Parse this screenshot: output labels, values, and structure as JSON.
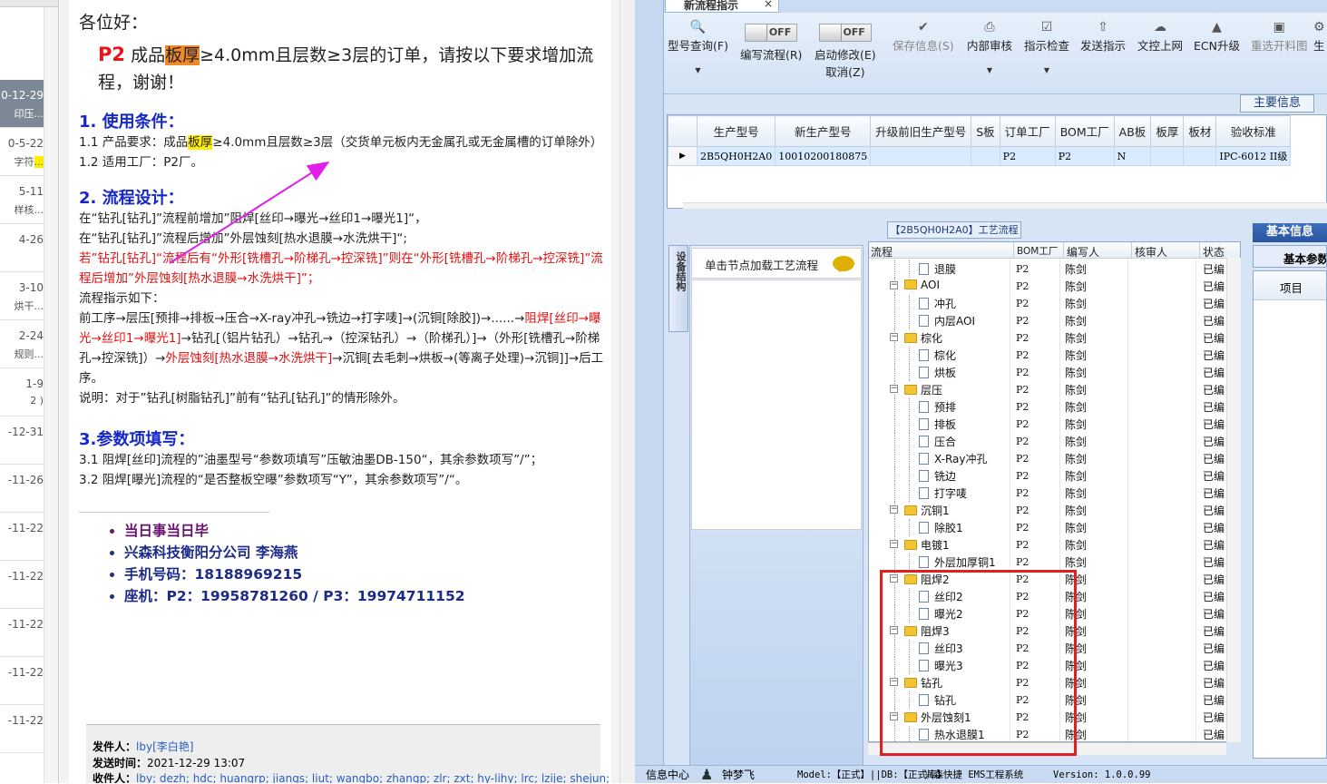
{
  "datelist": {
    "items": [
      {
        "date": "0-12-29",
        "sub": "印压...",
        "selected": true
      },
      {
        "date": "0-5-22",
        "sub": "字符",
        "highlight": "..."
      },
      {
        "date": "5-11",
        "sub": "样核..."
      },
      {
        "date": "4-26",
        "sub": ""
      },
      {
        "date": "3-10",
        "sub": "烘干..."
      },
      {
        "date": "2-24",
        "sub": "规则..."
      },
      {
        "date": "1-9",
        "sub": "2 )"
      },
      {
        "date": "-12-31",
        "sub": ""
      },
      {
        "date": "-11-26",
        "sub": ""
      },
      {
        "date": "-11-22",
        "sub": ""
      },
      {
        "date": "-11-22",
        "sub": ""
      },
      {
        "date": "-11-22",
        "sub": ""
      },
      {
        "date": "-11-22",
        "sub": ""
      },
      {
        "date": "-11-22",
        "sub": ""
      }
    ]
  },
  "email": {
    "greeting": "各位好：",
    "intro_p2": "P2",
    "intro_a": "成品",
    "intro_hl": "板厚",
    "intro_b": "≥4.0mm且层数≥3层的订单，请按以下要求增加流程，谢谢！",
    "s1_title": "1. 使用条件：",
    "s1_l1a": "1.1  产品要求：成品",
    "s1_l1hl": "板厚",
    "s1_l1b": "≥4.0mm且层数≥3层（交货单元板内无金属孔或无金属槽的订单除外）",
    "s1_l2": "1.2  适用工厂：P2厂。",
    "s2_title": "2. 流程设计：",
    "s2_l1": "在“钻孔[钻孔]”流程前增加”阻焊[丝印→曝光→丝印1→曝光1]“，",
    "s2_l2": "在“钻孔[钻孔]”流程后增加”外层蚀刻[热水退膜→水洗烘干]“;",
    "s2_l3": "若”钻孔[钻孔]“流程后有“外形[铣槽孔→阶梯孔→控深铣]”则在“外形[铣槽孔→阶梯孔→控深铣]”流程后增加”外层蚀刻[热水退膜→水洗烘干]”；",
    "s2_l4": "流程指示如下：",
    "s2_l5a": "前工序→层压[预排→排板→压合→X-ray冲孔→铣边→打字唛]→(沉铜[除胶])→......→",
    "s2_l5r1": "阻焊[丝印→曝光→丝印1→曝光1]",
    "s2_l5b": "→钻孔[（铝片钻孔）→钻孔→（控深钻孔）→（阶梯孔）]→（外形[铣槽孔→阶梯孔→控深铣]）→",
    "s2_l5r2": "外层蚀刻[热水退膜→水洗烘干]",
    "s2_l5c": "→沉铜[去毛刺→烘板→(等离子处理)→沉铜]]→后工序。",
    "s2_l6": "说明：对于”钻孔[树脂钻孔]”前有“钻孔[钻孔]”的情形除外。",
    "s3_title": "3.参数项填写：",
    "s3_l1": "3.1 阻焊[丝印]流程的”油墨型号“参数项填写”压敏油墨DB-150“，其余参数项写”/”；",
    "s3_l2": "3.2 阻焊[曝光]流程的“是否整板空曝”参数项写“Y”，其余参数项写”/“。",
    "sig1": "当日事当日毕",
    "sig2": "兴森科技衡阳分公司   李海燕",
    "sig3": "手机号码：18188969215",
    "sig4": "座机：P2：19958781260 / P3：19974711152",
    "meta_from_label": "发件人：",
    "meta_from": "lby[李白艳]",
    "meta_time_label": "发送时间：",
    "meta_time": "2021-12-29 13:07",
    "meta_to_label": "收件人：",
    "meta_to": "lby; dezh; hdc; huangrp; jiangs; liut; wangbo; zhangp; zlr; zxt; hy-lihy; lrc; lzije; shejun;"
  },
  "app": {
    "tab_label": "新流程指示",
    "toolbar": [
      {
        "label": "型号查询(F)",
        "icon": "search-icon",
        "dropdown": true
      },
      {
        "label": "编写流程(R)",
        "toggle": "OFF"
      },
      {
        "label": "启动修改(E)",
        "label2": "取消(Z)",
        "toggle": "OFF"
      },
      {
        "label": "保存信息(S)",
        "icon": "check-icon",
        "disabled": true
      },
      {
        "label": "内部审核",
        "icon": "printer-icon",
        "dropdown": true
      },
      {
        "label": "指示检查",
        "icon": "checkbox-icon",
        "dropdown": true
      },
      {
        "label": "发送指示",
        "icon": "upload-icon"
      },
      {
        "label": "文控上网",
        "icon": "cloud-upload-icon"
      },
      {
        "label": "ECN升级",
        "icon": "upgrade-icon"
      },
      {
        "label": "重选开料图",
        "icon": "image-icon",
        "disabled": true
      },
      {
        "label": "生",
        "icon": "generate-icon"
      }
    ],
    "main_info_label": "主要信息",
    "grid": {
      "columns": [
        "生产型号",
        "新生产型号",
        "升级前旧生产型号",
        "S板",
        "订单工厂",
        "BOM工厂",
        "AB板",
        "板厚",
        "板材",
        "验收标准"
      ],
      "rows": [
        [
          "2B5QH0H2A0",
          "10010200180875",
          "",
          "",
          "P2",
          "P2",
          "N",
          "",
          "",
          "IPC-6012 II级"
        ]
      ]
    },
    "process_title": "【2B5QH0H2A0】工艺流程",
    "side_tab": "设备结构",
    "click_hint": "单击节点加载工艺流程",
    "tree_columns": [
      "流程",
      "BOM工厂",
      "编写人",
      "核审人",
      "状态"
    ],
    "tree": [
      {
        "name": "退膜",
        "level": 2,
        "bom": "P2",
        "writer": "陈剑",
        "status": "已编"
      },
      {
        "name": "AOI",
        "level": 1,
        "bom": "P2",
        "writer": "陈剑",
        "status": "已编"
      },
      {
        "name": "冲孔",
        "level": 2,
        "bom": "P2",
        "writer": "陈剑",
        "status": "已编"
      },
      {
        "name": "内层AOI",
        "level": 2,
        "bom": "P2",
        "writer": "陈剑",
        "status": "已编"
      },
      {
        "name": "棕化",
        "level": 1,
        "bom": "P2",
        "writer": "陈剑",
        "status": "已编"
      },
      {
        "name": "棕化",
        "level": 2,
        "bom": "P2",
        "writer": "陈剑",
        "status": "已编"
      },
      {
        "name": "烘板",
        "level": 2,
        "bom": "P2",
        "writer": "陈剑",
        "status": "已编"
      },
      {
        "name": "层压",
        "level": 1,
        "bom": "P2",
        "writer": "陈剑",
        "status": "已编"
      },
      {
        "name": "预排",
        "level": 2,
        "bom": "P2",
        "writer": "陈剑",
        "status": "已编"
      },
      {
        "name": "排板",
        "level": 2,
        "bom": "P2",
        "writer": "陈剑",
        "status": "已编"
      },
      {
        "name": "压合",
        "level": 2,
        "bom": "P2",
        "writer": "陈剑",
        "status": "已编"
      },
      {
        "name": "X-Ray冲孔",
        "level": 2,
        "bom": "P2",
        "writer": "陈剑",
        "status": "已编"
      },
      {
        "name": "铣边",
        "level": 2,
        "bom": "P2",
        "writer": "陈剑",
        "status": "已编"
      },
      {
        "name": "打字唛",
        "level": 2,
        "bom": "P2",
        "writer": "陈剑",
        "status": "已编"
      },
      {
        "name": "沉铜1",
        "level": 1,
        "bom": "P2",
        "writer": "陈剑",
        "status": "已编"
      },
      {
        "name": "除胶1",
        "level": 2,
        "bom": "P2",
        "writer": "陈剑",
        "status": "已编"
      },
      {
        "name": "电镀1",
        "level": 1,
        "bom": "P2",
        "writer": "陈剑",
        "status": "已编"
      },
      {
        "name": "外层加厚铜1",
        "level": 2,
        "bom": "P2",
        "writer": "陈剑",
        "status": "已编"
      },
      {
        "name": "阻焊2",
        "level": 1,
        "bom": "P2",
        "writer": "陈剑",
        "status": "已编"
      },
      {
        "name": "丝印2",
        "level": 2,
        "bom": "P2",
        "writer": "陈剑",
        "status": "已编"
      },
      {
        "name": "曝光2",
        "level": 2,
        "bom": "P2",
        "writer": "陈剑",
        "status": "已编"
      },
      {
        "name": "阻焊3",
        "level": 1,
        "bom": "P2",
        "writer": "陈剑",
        "status": "已编"
      },
      {
        "name": "丝印3",
        "level": 2,
        "bom": "P2",
        "writer": "陈剑",
        "status": "已编"
      },
      {
        "name": "曝光3",
        "level": 2,
        "bom": "P2",
        "writer": "陈剑",
        "status": "已编"
      },
      {
        "name": "钻孔",
        "level": 1,
        "bom": "P2",
        "writer": "陈剑",
        "status": "已编"
      },
      {
        "name": "钻孔",
        "level": 2,
        "bom": "P2",
        "writer": "陈剑",
        "status": "已编"
      },
      {
        "name": "外层蚀刻1",
        "level": 1,
        "bom": "P2",
        "writer": "陈剑",
        "status": "已编"
      },
      {
        "name": "热水退膜1",
        "level": 2,
        "bom": "P2",
        "writer": "陈剑",
        "status": "已编"
      }
    ],
    "right_tab": "基本信息",
    "right_sub": "基本参数",
    "right_col": "项目",
    "status": {
      "info_center": "信息中心",
      "user": "钟梦飞",
      "model": "Model:【正式】||DB:【正式库】",
      "app_name": "兴森快捷 EMS工程系统",
      "version": "Version: 1.0.0.99"
    }
  },
  "colors": {
    "arrow": "#e020e8",
    "highlight_box": "#e02020",
    "accent_blue": "#1528c8",
    "alert_red": "#e01010"
  }
}
